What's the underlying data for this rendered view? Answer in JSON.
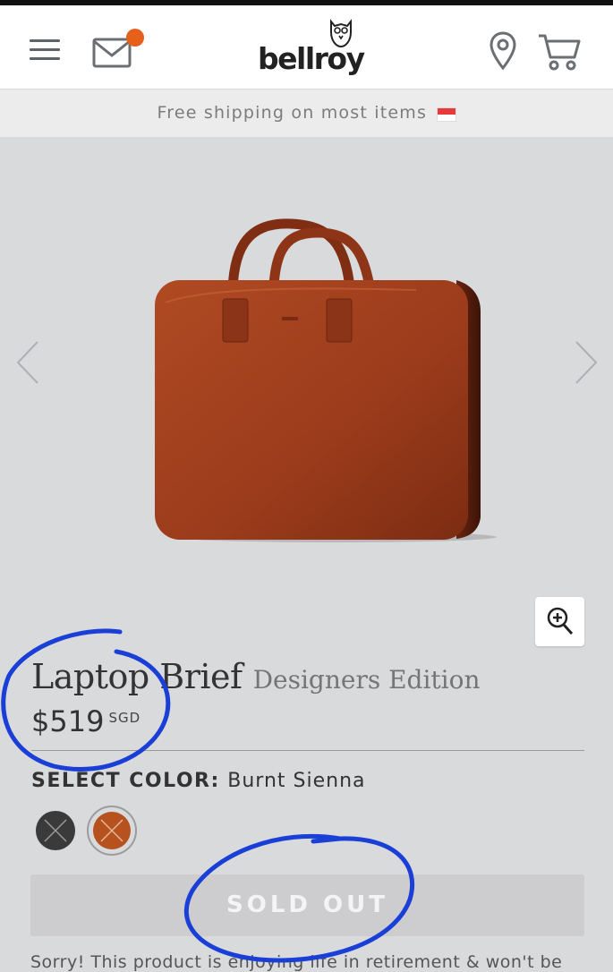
{
  "header": {
    "logo_text": "bellroy",
    "icons": [
      "menu-icon",
      "mail-icon",
      "owl-icon",
      "location-pin-icon",
      "cart-icon"
    ],
    "notification_dot_color": "#e4601b"
  },
  "promo": {
    "text": "Free shipping on most items",
    "flag_icon": "singapore-flag-icon"
  },
  "gallery": {
    "prev_icon": "chevron-left-icon",
    "next_icon": "chevron-right-icon",
    "zoom_icon": "zoom-in-icon"
  },
  "product": {
    "title": "Laptop Brief",
    "edition": "Designers Edition",
    "price": "$519",
    "currency": "SGD"
  },
  "color": {
    "label": "SELECT COLOR:",
    "selected": "Burnt Sienna",
    "swatches": [
      {
        "name": "black",
        "hex": "#3a3a3a"
      },
      {
        "name": "Burnt Sienna",
        "hex": "#b5521d"
      }
    ]
  },
  "purchase": {
    "button_label": "SOLD OUT",
    "note": "Sorry! This product is enjoying life in retirement & won't be"
  },
  "colors": {
    "background": "#d9dadc",
    "annotation_blue": "#1a3fd6",
    "bag_leather": "#9e3e1e"
  }
}
